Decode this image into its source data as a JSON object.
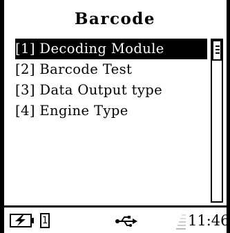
{
  "title": "Barcode",
  "menu": {
    "items": [
      {
        "label": "[1] Decoding Module",
        "selected": true
      },
      {
        "label": "[2] Barcode Test",
        "selected": false
      },
      {
        "label": "[3] Data Output type",
        "selected": false
      },
      {
        "label": "[4] Engine Type",
        "selected": false
      }
    ]
  },
  "status": {
    "battery_icon": "battery-charging-icon",
    "indicator": "1",
    "usb_icon": "usb-icon",
    "signal_icon": "signal-icon",
    "time": "11:46"
  }
}
